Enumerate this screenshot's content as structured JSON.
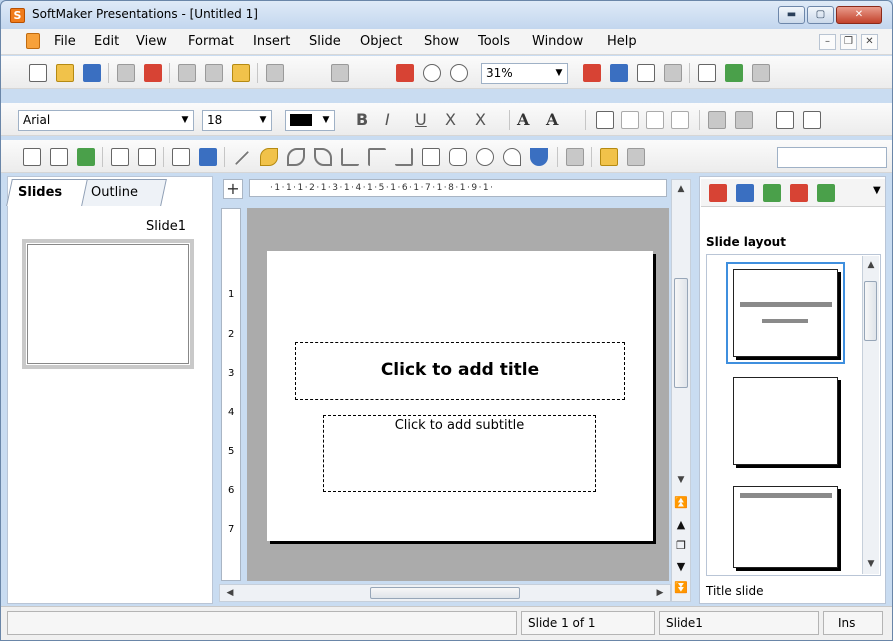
{
  "window": {
    "title": "SoftMaker Presentations - [Untitled 1]",
    "app_icon_letter": "S"
  },
  "menu": {
    "items": [
      "File",
      "Edit",
      "View",
      "Format",
      "Insert",
      "Slide",
      "Object",
      "Show",
      "Tools",
      "Window",
      "Help"
    ]
  },
  "toolbar1": {
    "zoom": "31%",
    "icons": [
      "new-icon",
      "open-icon",
      "save-icon",
      "print-icon",
      "pdf-icon",
      "cut-icon",
      "copy-icon",
      "paste-icon",
      "undo-icon",
      "redo-icon",
      "actual-size-icon",
      "zoom-icon",
      "search-icon",
      "text-frame-icon",
      "table-icon",
      "outline-icon",
      "paint-icon",
      "pilcrow-icon",
      "spellcheck-icon",
      "columns-icon"
    ]
  },
  "toolbar2": {
    "font": "Arial",
    "size": "18",
    "bold": "B",
    "italic": "I",
    "underline": "U",
    "strike": "X",
    "double_strike": "X",
    "superscript": "A",
    "subscript": "A"
  },
  "tabs": {
    "slides": "Slides",
    "outline": "Outline"
  },
  "thumbnails": [
    {
      "label": "Slide1"
    }
  ],
  "ruler": {
    "horizontal": "·1·1·1·2·1·3·1·4·1·5·1·6·1·7·1·8·1·9·1·",
    "vertical_numbers": [
      "1",
      "2",
      "3",
      "4",
      "5",
      "6",
      "7"
    ]
  },
  "slide": {
    "title_placeholder": "Click to add title",
    "subtitle_placeholder": "Click to add subtitle"
  },
  "right_panel": {
    "heading": "Slide layout",
    "selected_layout": "Title slide"
  },
  "status": {
    "slide_pos": "Slide 1 of 1",
    "slide_name": "Slide1",
    "mode": "Ins"
  }
}
